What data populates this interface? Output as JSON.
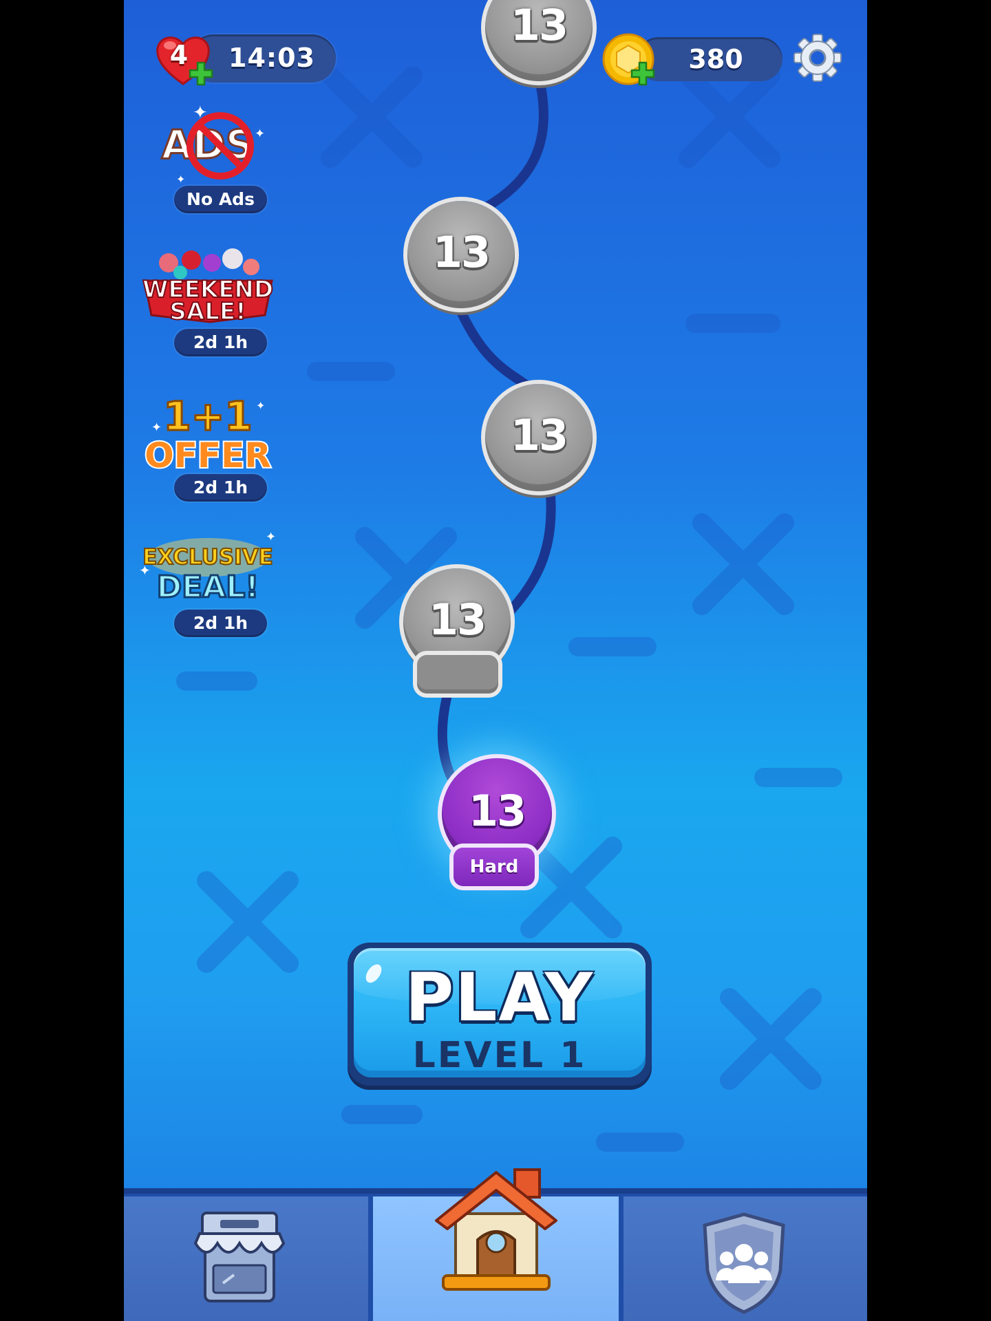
{
  "hud": {
    "lives": "4",
    "lives_timer": "14:03",
    "coins": "380"
  },
  "promos": [
    {
      "art_text_1": "ADS",
      "label": "No Ads"
    },
    {
      "art_text_1": "WEEKEND",
      "art_text_2": "SALE!",
      "label": "2d 1h"
    },
    {
      "art_text_1": "1+1",
      "art_text_2": "OFFER",
      "label": "2d 1h"
    },
    {
      "art_text_1": "EXCLUSIVE",
      "art_text_2": "DEAL!",
      "label": "2d 1h"
    }
  ],
  "level_map": {
    "nodes": [
      "13",
      "13",
      "13",
      "13"
    ],
    "current": {
      "number": "13",
      "difficulty": "Hard"
    }
  },
  "play_button": {
    "label": "PLAY",
    "sublabel": "LEVEL 1"
  },
  "colors": {
    "background_top": "#1e5fd8",
    "background_mid": "#1aa7ef",
    "current_level": "#8f2fc6",
    "locked_level": "#9a9a9a",
    "play_button": "#2bb3f5",
    "pill": "#2e4f96"
  },
  "icons": {
    "lives": "heart-icon",
    "coins": "coin-icon",
    "settings": "gear-icon",
    "shop_tab": "shop-icon",
    "home_tab": "house-icon",
    "team_tab": "team-shield-icon"
  }
}
